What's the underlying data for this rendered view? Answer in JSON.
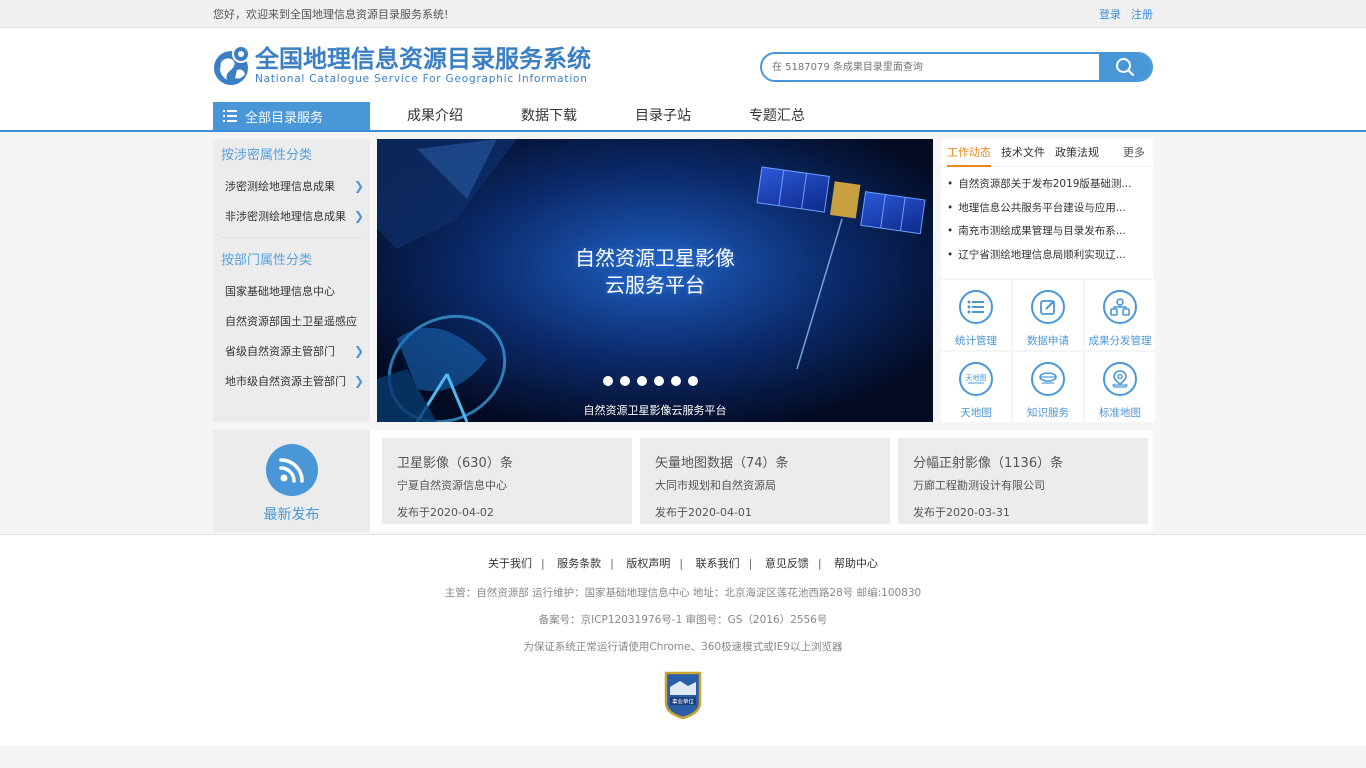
{
  "topbar": {
    "welcome": "您好，欢迎来到全国地理信息资源目录服务系统!",
    "login": "登录",
    "register": "注册"
  },
  "header": {
    "title_cn": "全国地理信息资源目录服务系统",
    "title_en": "National Catalogue Service For Geographic Information",
    "search_placeholder": "在 5187079 条成果目录里面查询"
  },
  "nav": {
    "all": "全部目录服务",
    "items": [
      "成果介绍",
      "数据下载",
      "目录子站",
      "专题汇总"
    ]
  },
  "sidebar": {
    "section1": "按涉密属性分类",
    "items1": [
      "涉密测绘地理信息成果",
      "非涉密测绘地理信息成果"
    ],
    "section2": "按部门属性分类",
    "items2": [
      "国家基础地理信息中心",
      "自然资源部国土卫星遥感应",
      "省级自然资源主管部门",
      "地市级自然资源主管部门"
    ]
  },
  "banner": {
    "title_line1": "自然资源卫星影像",
    "title_line2": "云服务平台",
    "caption": "自然资源卫星影像云服务平台"
  },
  "news": {
    "tabs": [
      "工作动态",
      "技术文件",
      "政策法规"
    ],
    "more": "更多",
    "items": [
      "自然资源部关于发布2019版基础测...",
      "地理信息公共服务平台建设与应用...",
      "南充市测绘成果管理与目录发布系...",
      "辽宁省测绘地理信息局顺利实现辽..."
    ]
  },
  "services": [
    {
      "label": "统计管理",
      "icon": "list-icon"
    },
    {
      "label": "数据申请",
      "icon": "edit-icon"
    },
    {
      "label": "成果分发管理",
      "icon": "org-chart-icon"
    },
    {
      "label": "天地图",
      "icon": "tianditu-icon"
    },
    {
      "label": "知识服务",
      "icon": "knowledge-icon"
    },
    {
      "label": "标准地图",
      "icon": "map-pin-icon"
    }
  ],
  "latest": {
    "label": "最新发布",
    "cards": [
      {
        "title": "卫星影像（630）条",
        "org": "宁夏自然资源信息中心",
        "date": "发布于2020-04-02"
      },
      {
        "title": "矢量地图数据（74）条",
        "org": "大同市规划和自然资源局",
        "date": "发布于2020-04-01"
      },
      {
        "title": "分幅正射影像（1136）条",
        "org": "万廊工程勘测设计有限公司",
        "date": "发布于2020-03-31"
      }
    ]
  },
  "footer": {
    "links": [
      "关于我们",
      "服务条款",
      "版权声明",
      "联系我们",
      "意见反馈",
      "帮助中心"
    ],
    "line1": "主管：自然资源部 运行维护：国家基础地理信息中心 地址：北京海淀区莲花池西路28号 邮编:100830",
    "line2": "备案号：京ICP12031976号-1 审图号：GS（2016）2556号",
    "line3": "为保证系统正常运行请使用Chrome、360极速模式或IE9以上浏览器",
    "badge_text": "事业单位"
  },
  "colors": {
    "accent": "#4a97d8",
    "active_tab": "#e8891e"
  }
}
